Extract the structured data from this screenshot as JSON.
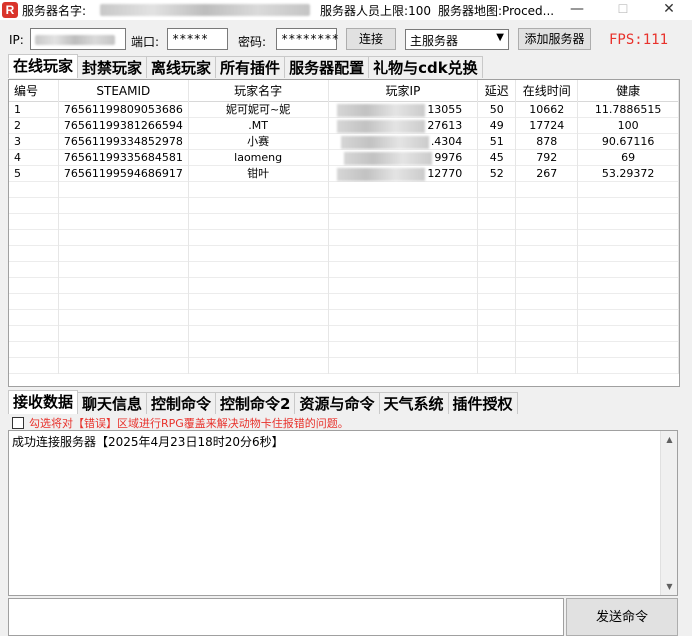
{
  "window": {
    "icon_letter": "R",
    "server_name_label": "服务器名字:",
    "max_players_label": "服务器人员上限:100",
    "map_label": "服务器地图:Proced...",
    "minimize": "—",
    "maximize": "☐",
    "close": "✕"
  },
  "connection": {
    "ip_label": "IP:",
    "port_label": "端口:",
    "port_value": "*****",
    "password_label": "密码:",
    "password_value": "********",
    "connect_button": "连接",
    "server_select": "主服务器",
    "add_server_button": "添加服务器",
    "fps": "FPS:111"
  },
  "top_tabs": [
    "在线玩家",
    "封禁玩家",
    "离线玩家",
    "所有插件",
    "服务器配置",
    "礼物与cdk兑换"
  ],
  "players_table": {
    "headers": [
      "编号",
      "STEAMID",
      "玩家名字",
      "玩家IP",
      "延迟",
      "在线时间",
      "健康"
    ],
    "rows": [
      {
        "id": "1",
        "steamid": "76561199809053686",
        "name": "妮可妮可~妮",
        "ip": "13055",
        "ping": "50",
        "online": "10662",
        "health": "11.7886515"
      },
      {
        "id": "2",
        "steamid": "76561199381266594",
        "name": ".MT",
        "ip": "27613",
        "ping": "49",
        "online": "17724",
        "health": "100"
      },
      {
        "id": "3",
        "steamid": "76561199334852978",
        "name": "小赛",
        "ip": ".4304",
        "ping": "51",
        "online": "878",
        "health": "90.67116"
      },
      {
        "id": "4",
        "steamid": "76561199335684581",
        "name": "laomeng",
        "ip": "9976",
        "ping": "45",
        "online": "792",
        "health": "69"
      },
      {
        "id": "5",
        "steamid": "76561199594686917",
        "name": "钳叶",
        "ip": "12770",
        "ping": "52",
        "online": "267",
        "health": "53.29372"
      }
    ]
  },
  "bottom_tabs": [
    "接收数据",
    "聊天信息",
    "控制命令",
    "控制命令2",
    "资源与命令",
    "天气系统",
    "插件授权"
  ],
  "checkbox_label": "勾选将对【错误】区域进行RPG覆盖来解决动物卡住报错的问题。",
  "log_text": "成功连接服务器【2025年4月23日18时20分6秒】",
  "send_button": "发送命令"
}
